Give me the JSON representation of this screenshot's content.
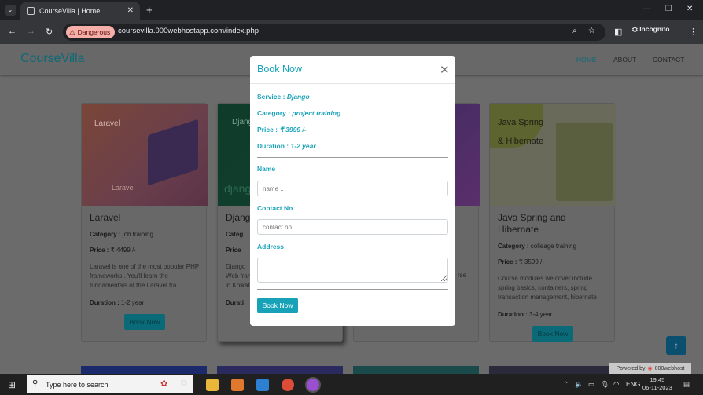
{
  "browser": {
    "tab_title": "CourseVilla | Home",
    "security_label": "Dangerous",
    "url": "coursevilla.000webhostapp.com/index.php",
    "profile_label": "Incognito"
  },
  "site": {
    "brand": "CourseVilla",
    "nav": [
      "HOME",
      "ABOUT",
      "CONTACT"
    ]
  },
  "cards": [
    {
      "img_title": "Laravel",
      "img_sub": "Laravel",
      "title": "Laravel",
      "category_label": "Category :",
      "category": "job training",
      "price_label": "Price :",
      "price": "₹ 4499 /-",
      "desc": "Laravel is one of the most popular PHP frameworks . You'll learn the fundamentals of the Laravel fra",
      "duration_label": "Duration :",
      "duration": "1-2 year",
      "button": "Book Now"
    },
    {
      "img_title": "Django",
      "img_sub": "django",
      "title": "Djang",
      "category_label": "Categ",
      "price_label": "Price",
      "desc": "Django i Web fran in Kolkat",
      "duration_label": "Durati"
    },
    {
      "desc": "rse"
    },
    {
      "img_title": "Java Spring & Hibernate",
      "title": "Java Spring and Hibernate",
      "category_label": "Category :",
      "category": "colleage training",
      "price_label": "Price :",
      "price": "₹ 3599 /-",
      "desc": "Course modules we cover include spring basics, containers, spring transaction management, hibernate",
      "duration_label": "Duration :",
      "duration": "3-4 year",
      "button": "Book Now"
    }
  ],
  "modal": {
    "title": "Book Now",
    "service_label": "Service :",
    "service": "Django",
    "category_label": "Category :",
    "category": "project training",
    "price_label": "Price :",
    "price": "₹ 3999 /-",
    "duration_label": "Duration :",
    "duration": "1-2 year",
    "name_label": "Name",
    "name_placeholder": "name ..",
    "contact_label": "Contact No",
    "contact_placeholder": "contact no ..",
    "address_label": "Address",
    "submit": "Book Now"
  },
  "powered_by": "Powered by",
  "powered_brand": "000webhost",
  "taskbar": {
    "search_placeholder": "Type here to search",
    "lang": "ENG",
    "time": "19:45",
    "date": "06-11-2023"
  }
}
